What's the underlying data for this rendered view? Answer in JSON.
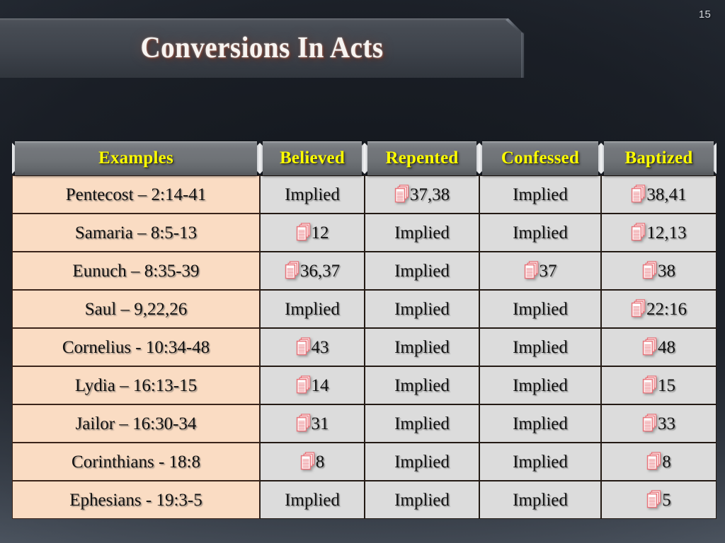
{
  "slide": {
    "number": "15",
    "title": "Conversions In Acts",
    "accent_yellow": "#ffff00",
    "example_cell_color": "#fadcc3",
    "data_cell_color": "#dcdcdc",
    "background_color": "#272d36",
    "icon_color": "#e8737a"
  },
  "table": {
    "headers": [
      {
        "label": "Examples"
      },
      {
        "label": "Believed"
      },
      {
        "label": "Repented"
      },
      {
        "label": "Confessed"
      },
      {
        "label": "Baptized"
      }
    ],
    "rows": [
      {
        "example": "Pentecost – 2:14-41",
        "believed": {
          "text": "Implied",
          "icon": false
        },
        "repented": {
          "text": "37,38",
          "icon": true
        },
        "confessed": {
          "text": "Implied",
          "icon": false
        },
        "baptized": {
          "text": "38,41",
          "icon": true
        }
      },
      {
        "example": "Samaria – 8:5-13",
        "believed": {
          "text": "12",
          "icon": true
        },
        "repented": {
          "text": "Implied",
          "icon": false
        },
        "confessed": {
          "text": "Implied",
          "icon": false
        },
        "baptized": {
          "text": "12,13",
          "icon": true
        }
      },
      {
        "example": "Eunuch – 8:35-39",
        "believed": {
          "text": "36,37",
          "icon": true
        },
        "repented": {
          "text": "Implied",
          "icon": false
        },
        "confessed": {
          "text": "37",
          "icon": true
        },
        "baptized": {
          "text": "38",
          "icon": true
        }
      },
      {
        "example": "Saul – 9,22,26",
        "believed": {
          "text": "Implied",
          "icon": false
        },
        "repented": {
          "text": "Implied",
          "icon": false
        },
        "confessed": {
          "text": "Implied",
          "icon": false
        },
        "baptized": {
          "text": "22:16",
          "icon": true
        }
      },
      {
        "example": "Cornelius - 10:34-48",
        "believed": {
          "text": "43",
          "icon": true
        },
        "repented": {
          "text": "Implied",
          "icon": false
        },
        "confessed": {
          "text": "Implied",
          "icon": false
        },
        "baptized": {
          "text": "48",
          "icon": true
        }
      },
      {
        "example": "Lydia – 16:13-15",
        "believed": {
          "text": "14",
          "icon": true
        },
        "repented": {
          "text": "Implied",
          "icon": false
        },
        "confessed": {
          "text": "Implied",
          "icon": false
        },
        "baptized": {
          "text": "15",
          "icon": true
        }
      },
      {
        "example": "Jailor – 16:30-34",
        "believed": {
          "text": "31",
          "icon": true
        },
        "repented": {
          "text": "Implied",
          "icon": false
        },
        "confessed": {
          "text": "Implied",
          "icon": false
        },
        "baptized": {
          "text": "33",
          "icon": true
        }
      },
      {
        "example": "Corinthians - 18:8",
        "believed": {
          "text": "8",
          "icon": true
        },
        "repented": {
          "text": "Implied",
          "icon": false
        },
        "confessed": {
          "text": "Implied",
          "icon": false
        },
        "baptized": {
          "text": "8",
          "icon": true
        }
      },
      {
        "example": "Ephesians - 19:3-5",
        "believed": {
          "text": "Implied",
          "icon": false
        },
        "repented": {
          "text": "Implied",
          "icon": false
        },
        "confessed": {
          "text": "Implied",
          "icon": false
        },
        "baptized": {
          "text": "5",
          "icon": true
        }
      }
    ]
  }
}
